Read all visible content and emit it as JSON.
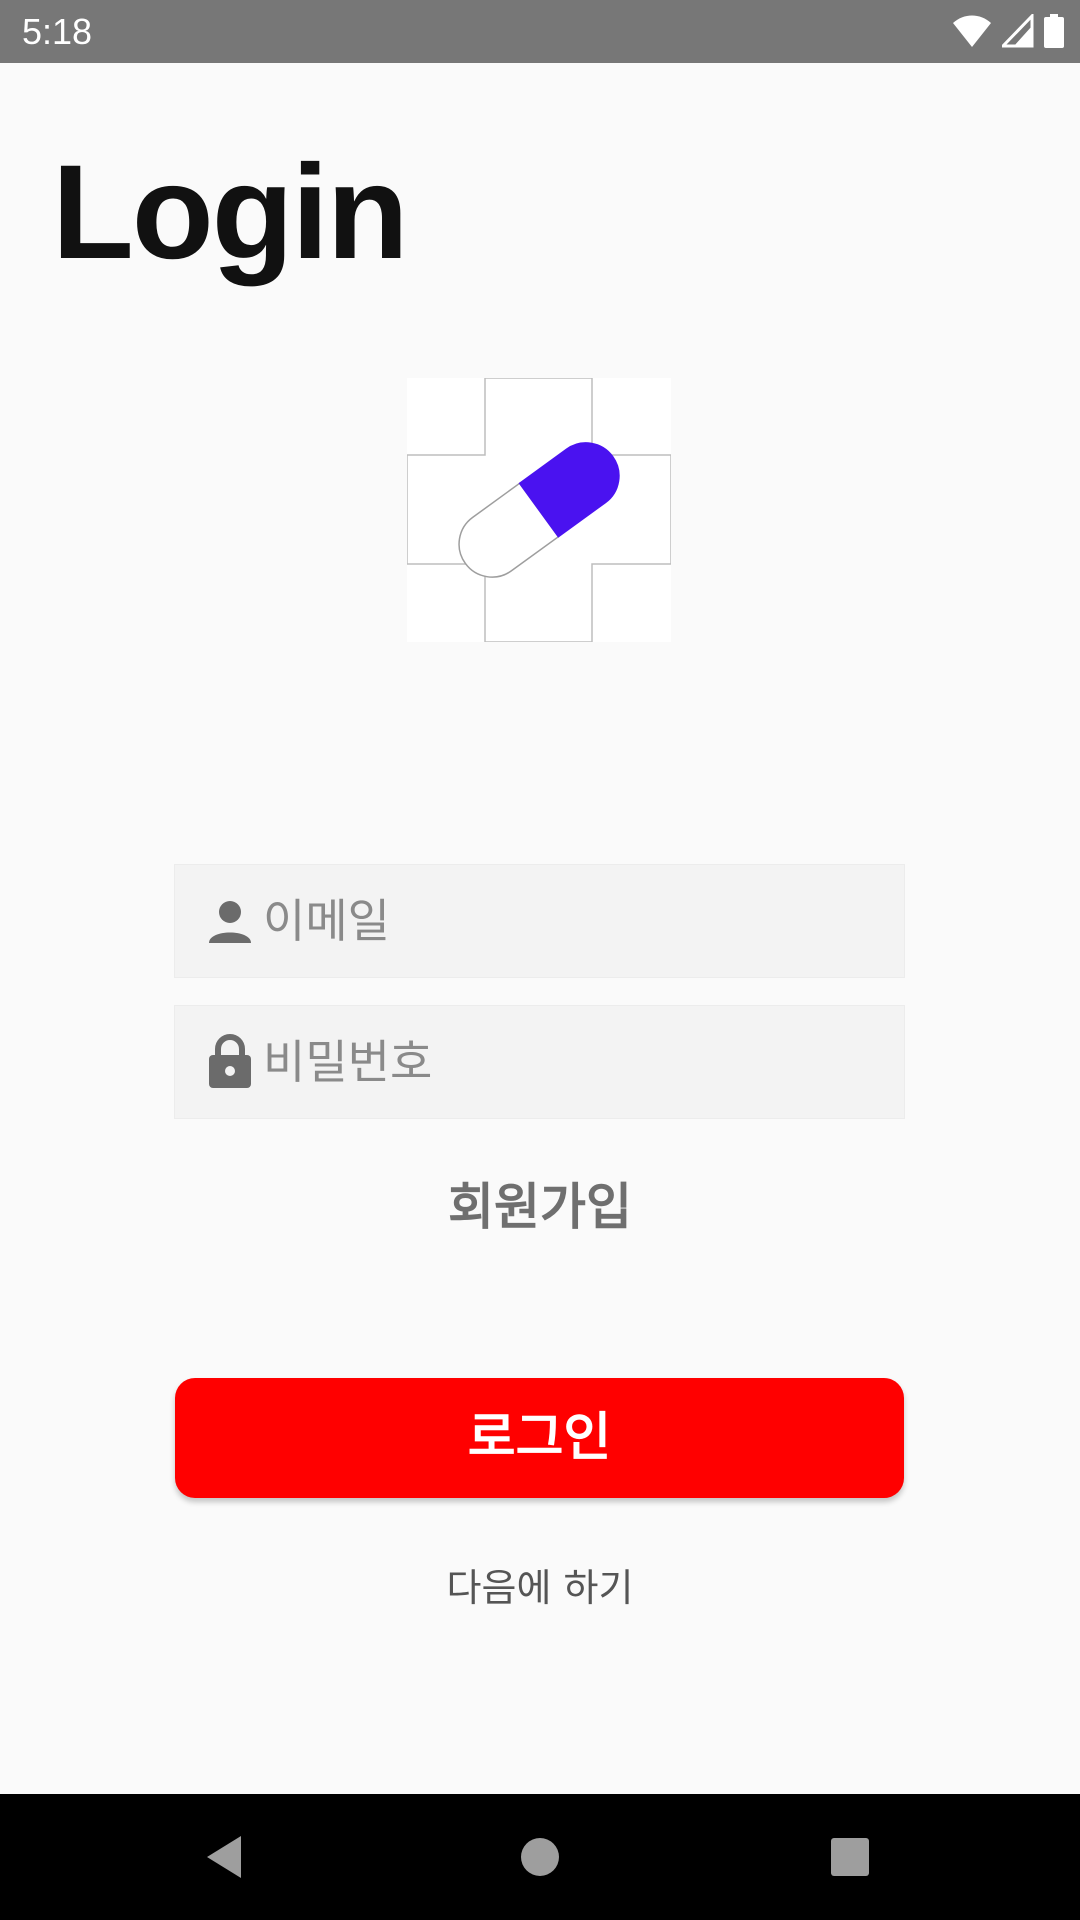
{
  "status_bar": {
    "time": "5:18",
    "icons": [
      "wifi-icon",
      "cell-signal-icon",
      "battery-icon"
    ],
    "background": "#777777"
  },
  "title": "Login",
  "logo": {
    "icon": "pill-cross-logo",
    "pill_color": "#4a12f0"
  },
  "form": {
    "email": {
      "placeholder": "이메일",
      "value": "",
      "icon": "person-icon"
    },
    "password": {
      "placeholder": "비밀번호",
      "value": "",
      "icon": "lock-icon"
    }
  },
  "signup_label": "회원가입",
  "login_button": {
    "label": "로그인",
    "color": "#ff0000"
  },
  "later_label": "다음에 하기",
  "nav_bar": {
    "buttons": [
      "back-icon",
      "home-icon",
      "recents-icon"
    ]
  }
}
